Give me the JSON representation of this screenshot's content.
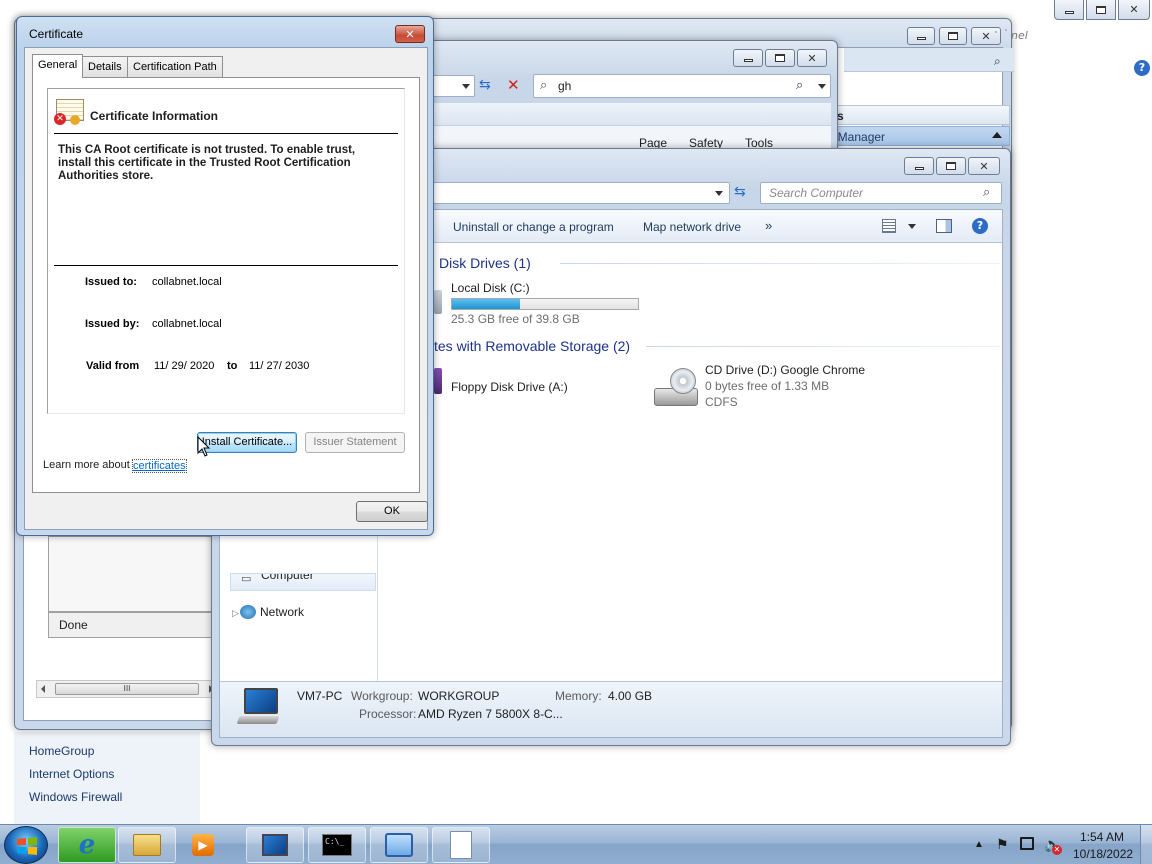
{
  "control_panel": {
    "links": [
      "HomeGroup",
      "Internet Options",
      "Windows Firewall"
    ]
  },
  "ie_back": {
    "search_placeholder": "nel",
    "status": "Done",
    "actions_header": "ions",
    "actions_item": "ice Manager",
    "hscroll_grip": "III"
  },
  "ie_mid": {
    "search_value": "gh",
    "menu": [
      "Page",
      "Safety",
      "Tools"
    ]
  },
  "explorer": {
    "search_placeholder": "Search Computer",
    "commands": [
      "Uninstall or change a program",
      "Map network drive",
      "»"
    ],
    "groups": {
      "hdd": "Disk Drives (1)",
      "removable": "tes with Removable Storage (2)"
    },
    "local_disk": {
      "name": "Local Disk (C:)",
      "free": "25.3 GB free of 39.8 GB",
      "used_fraction": 0.364
    },
    "floppy": {
      "name": "Floppy Disk Drive (A:)"
    },
    "cd": {
      "name": "CD Drive (D:) Google Chrome",
      "free": "0 bytes free of 1.33 MB",
      "fs": "CDFS"
    },
    "nav": {
      "computer": "Computer",
      "network": "Network"
    },
    "details": {
      "pc_name": "VM7-PC",
      "workgroup_label": "Workgroup:",
      "workgroup": "WORKGROUP",
      "memory_label": "Memory:",
      "memory": "4.00 GB",
      "processor_label": "Processor:",
      "processor": "AMD Ryzen 7 5800X 8-C..."
    }
  },
  "cert": {
    "title": "Certificate",
    "tabs": [
      "General",
      "Details",
      "Certification Path"
    ],
    "info_heading": "Certificate Information",
    "warning": "This CA Root certificate is not trusted. To enable trust, install this certificate in the Trusted Root Certification Authorities store.",
    "issued_to_label": "Issued to:",
    "issued_to": "collabnet.local",
    "issued_by_label": "Issued by:",
    "issued_by": "collabnet.local",
    "valid_from_label": "Valid from",
    "valid_from": "11/ 29/ 2020",
    "to_label": "to",
    "valid_to": "11/ 27/ 2030",
    "install_btn": "Install Certificate...",
    "issuer_btn": "Issuer Statement",
    "learn_more": "Learn more about",
    "learn_link": "certificates",
    "ok": "OK"
  },
  "taskbar": {
    "time": "1:54 AM",
    "date": "10/18/2022",
    "cmd_label": "C:\\_"
  },
  "colors": {
    "accent": "#1e3287",
    "link": "#0066cc",
    "disk_bar": "#26a0da"
  }
}
